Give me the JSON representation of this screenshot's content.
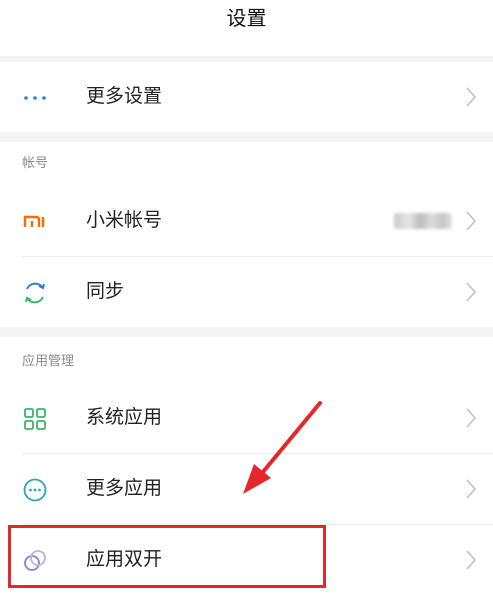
{
  "header": {
    "title": "设置"
  },
  "sections": {
    "account": "帐号",
    "app_management": "应用管理"
  },
  "items": {
    "more_settings": "更多设置",
    "mi_account": "小米帐号",
    "sync": "同步",
    "system_apps": "系统应用",
    "more_apps": "更多应用",
    "dual_apps": "应用双开"
  },
  "icons": {
    "more_settings": "ellipsis-icon",
    "mi_account": "mi-logo-icon",
    "sync": "sync-icon",
    "system_apps": "grid-icon",
    "more_apps": "more-circle-icon",
    "dual_apps": "dual-circles-icon",
    "chevron": "chevron-right-icon"
  },
  "colors": {
    "annotation": "#e6262a",
    "mi_orange": "#ff6a00",
    "icon_blue": "#2f7fd8",
    "icon_green": "#3bb56a",
    "icon_teal": "#2aa6b8",
    "icon_purple": "#8a7fd6"
  }
}
